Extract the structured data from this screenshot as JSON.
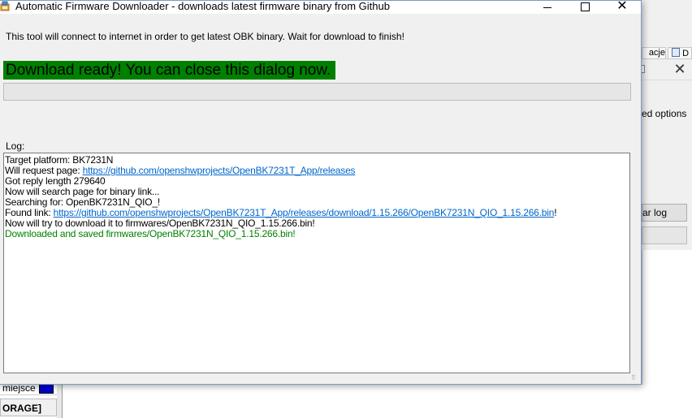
{
  "background": {
    "tab1_label": "acje",
    "tab2_label": "D",
    "close_glyph": "✕",
    "options_text": "ed options",
    "clear_log_label": "ar log",
    "list_row_label": "miejsce",
    "list_row_color": "#0000cc",
    "storage_label": "ORAGE]"
  },
  "dialog": {
    "title": "Automatic Firmware Downloader - downloads latest firmware binary from Github",
    "icon": "app-icon",
    "controls": {
      "minimize": "minimize-icon",
      "maximize": "maximize-icon",
      "close_glyph": "✕"
    },
    "info_text": "This tool will connect to internet in order to get latest OBK binary. Wait for download to finish!",
    "status_text": "Download ready! You can close this dialog now.",
    "status_color": "#008000",
    "progress_percent": 0,
    "log_label": "Log:",
    "log": {
      "platform": "Target platform: BK7231N",
      "request_prefix": "Will request page: ",
      "request_url": "https://github.com/openshwprojects/OpenBK7231T_App/releases",
      "reply": "Got reply length 279640",
      "search_page": "Now will search page for binary link...",
      "searching": "Searching for: OpenBK7231N_QIO_!",
      "found_prefix": "Found link: ",
      "found_url": "https://github.com/openshwprojects/OpenBK7231T_App/releases/download/1.15.266/OpenBK7231N_QIO_1.15.266.bin",
      "found_suffix": "!",
      "download_try": "Now will try to download it to firmwares/OpenBK7231N_QIO_1.15.266.bin!",
      "saved": "Downloaded and saved firmwares/OpenBK7231N_QIO_1.15.266.bin!",
      "saved_color": "#008000"
    }
  }
}
